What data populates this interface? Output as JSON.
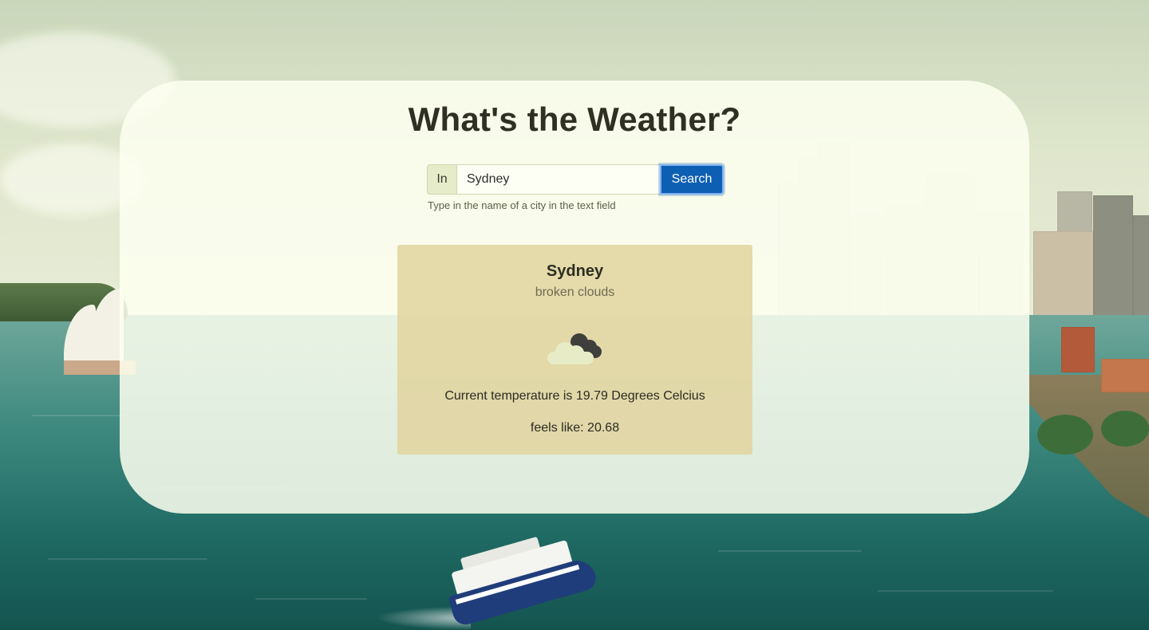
{
  "page": {
    "title": "What's the Weather?"
  },
  "search": {
    "prefix_label": "In",
    "city_value": "Sydney",
    "button_label": "Search",
    "help_text": "Type in the name of a city in the text field"
  },
  "weather": {
    "city": "Sydney",
    "description": "broken clouds",
    "icon": "broken-clouds-icon",
    "temperature_text": "Current temperature is 19.79 Degrees Celcius",
    "feels_like_text": "feels like: 20.68"
  },
  "colors": {
    "button": "#0d5fb3",
    "card": "#e0d29b",
    "panel": "#fdfff0"
  }
}
